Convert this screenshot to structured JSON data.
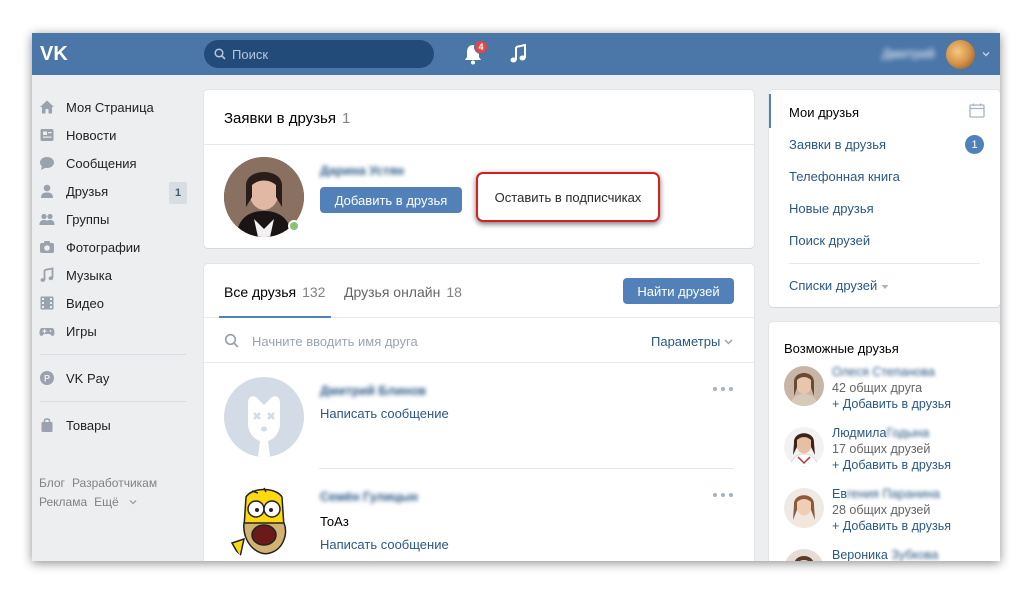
{
  "header": {
    "search_placeholder": "Поиск",
    "notifications_count": "4",
    "user_name": "Дмитрий"
  },
  "sidebar": {
    "items": [
      {
        "label": "Моя Страница",
        "icon": "home-icon"
      },
      {
        "label": "Новости",
        "icon": "news-icon"
      },
      {
        "label": "Сообщения",
        "icon": "messages-icon"
      },
      {
        "label": "Друзья",
        "icon": "friends-icon",
        "count": "1"
      },
      {
        "label": "Группы",
        "icon": "groups-icon"
      },
      {
        "label": "Фотографии",
        "icon": "camera-icon"
      },
      {
        "label": "Музыка",
        "icon": "music-icon"
      },
      {
        "label": "Видео",
        "icon": "video-icon"
      },
      {
        "label": "Игры",
        "icon": "games-icon"
      }
    ],
    "pay_label": "VK Pay",
    "goods_label": "Товары",
    "footer": {
      "blog": "Блог",
      "dev": "Разработчикам",
      "ads": "Реклама",
      "more": "Ещё"
    }
  },
  "requests": {
    "title": "Заявки в друзья",
    "count": "1",
    "name": "Дарина Устян",
    "add_label": "Добавить в друзья",
    "leave_label": "Оставить в подписчиках"
  },
  "friends": {
    "tab_all": "Все друзья",
    "tab_all_count": "132",
    "tab_online": "Друзья онлайн",
    "tab_online_count": "18",
    "find_label": "Найти друзей",
    "search_placeholder": "Начните вводить имя друга",
    "params_label": "Параметры",
    "list": [
      {
        "name": "Дмитрий Блинов",
        "sub": "",
        "message": "Написать сообщение"
      },
      {
        "name": "Семён Гулицын",
        "sub": "ТоАз",
        "message": "Написать сообщение"
      }
    ]
  },
  "right_menu": {
    "items": [
      "Мои друзья",
      "Заявки в друзья",
      "Телефонная книга",
      "Новые друзья",
      "Поиск друзей"
    ],
    "requests_badge": "1",
    "lists_label": "Списки друзей"
  },
  "possible": {
    "title": "Возможные друзья",
    "items": [
      {
        "name": "Олеся Степанова",
        "common": "42 общих друга",
        "add": "+ Добавить в друзья"
      },
      {
        "name_first": "Людмила",
        "name_rest": "Годына",
        "common": "17 общих друзей",
        "add": "+ Добавить в друзья"
      },
      {
        "name_first": "Ев",
        "name_rest": "гения Паранина",
        "common": "28 общих друзей",
        "add": "+ Добавить в друзья"
      },
      {
        "name_first": "Вероника",
        "name_rest": "Зубкова"
      }
    ]
  }
}
